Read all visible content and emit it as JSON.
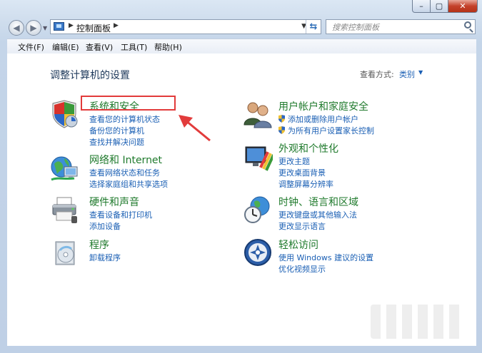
{
  "window": {
    "address": {
      "crumb": "控制面板"
    },
    "search": {
      "placeholder": "搜索控制面板"
    },
    "controls": {
      "minimize": "–",
      "maximize": "▢",
      "close": "✕"
    }
  },
  "menu": [
    "文件(F)",
    "编辑(E)",
    "查看(V)",
    "工具(T)",
    "帮助(H)"
  ],
  "content": {
    "title": "调整计算机的设置",
    "view_by_label": "查看方式:",
    "view_by_value": "类别"
  },
  "categories_left": [
    {
      "heading": "系统和安全",
      "links": [
        "查看您的计算机状态",
        "备份您的计算机",
        "查找并解决问题"
      ],
      "icon": "shield-icon"
    },
    {
      "heading": "网络和 Internet",
      "links": [
        "查看网络状态和任务",
        "选择家庭组和共享选项"
      ],
      "icon": "network-globe-icon"
    },
    {
      "heading": "硬件和声音",
      "links": [
        "查看设备和打印机",
        "添加设备"
      ],
      "icon": "printer-icon"
    },
    {
      "heading": "程序",
      "links": [
        "卸载程序"
      ],
      "icon": "programs-icon"
    }
  ],
  "categories_right": [
    {
      "heading": "用户帐户和家庭安全",
      "links": [
        "添加或删除用户帐户",
        "为所有用户设置家长控制"
      ],
      "icon": "users-icon",
      "links_have_shield": true
    },
    {
      "heading": "外观和个性化",
      "links": [
        "更改主题",
        "更改桌面背景",
        "调整屏幕分辨率"
      ],
      "icon": "appearance-icon"
    },
    {
      "heading": "时钟、语言和区域",
      "links": [
        "更改键盘或其他输入法",
        "更改显示语言"
      ],
      "icon": "clock-globe-icon"
    },
    {
      "heading": "轻松访问",
      "links": [
        "使用 Windows 建议的设置",
        "优化视频显示"
      ],
      "icon": "ease-of-access-icon"
    }
  ],
  "colors": {
    "heading": "#1f7a2c",
    "link": "#1a5fb4",
    "annotation": "#e23b3b"
  }
}
